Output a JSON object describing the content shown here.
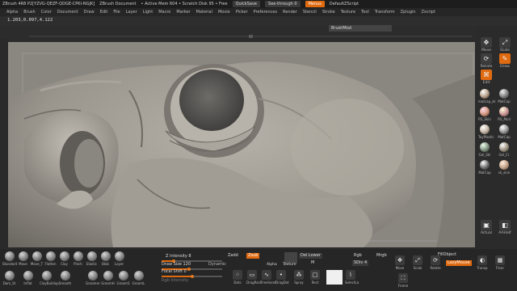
{
  "titlebar": {
    "app": "ZBrush 4R8 P2[YZVG-QEZF-QDGE-CPKI-NGJK]",
    "doc": "ZBrush Document",
    "mem": "• Active Mem 604 • Scratch Disk 95 • Free",
    "quicksave": "QuickSave",
    "seethrough": "See-through  0",
    "menus": "Menus",
    "script": "DefaultZScript"
  },
  "menubar": [
    "Alpha",
    "Brush",
    "Color",
    "Document",
    "Draw",
    "Edit",
    "File",
    "Layer",
    "Light",
    "Macro",
    "Marker",
    "Material",
    "Movie",
    "Picker",
    "Preferences",
    "Render",
    "Stencil",
    "Stroke",
    "Texture",
    "Tool",
    "Transform",
    "Zplugin",
    "Zscript"
  ],
  "coords": "1.203,0.097,4.122",
  "brush_name": "BrushMod",
  "right_shelf": {
    "move": "Move",
    "scale": "Scale",
    "rotate": "Rotate",
    "draw": "Draw",
    "edit": "Edit",
    "materials": [
      "matcap_sk",
      "MatCap",
      "RS_Skin",
      "RS_Mcd",
      "ToyPlastic",
      "MatCap",
      "Gel_Ski",
      "Gel_Cr",
      "MatCap",
      "sk_skin"
    ],
    "actual": "Actual",
    "aahalf": "AAHalf",
    "floor": "Floor",
    "persp": "Persp"
  },
  "brushes": [
    "Standard",
    "Move",
    "Move_T",
    "Flatten",
    "Clay",
    "Pinch",
    "Elastic",
    "Blob",
    "Layer",
    "Dam_St",
    "Inflat",
    "ClayBuildup",
    "Smooth",
    "Groomer",
    "GroomH",
    "GroomS",
    "GroomL"
  ],
  "controls": {
    "z_intensity": "Z Intensity 8",
    "draw_size": "Draw Size 120",
    "dynamic": "Dynamic",
    "focal_shift": "Focal Shift 0",
    "rgb_intensity": "Rgb Intensity",
    "zadd": "Zadd",
    "zsub": "Zsub",
    "del_lower": "Del Lower",
    "m": "M",
    "rgb": "Rgb",
    "mrgb": "Mrgb",
    "sdiv": "SDiv 4",
    "fill_object": "FillObject",
    "lazy_mouse": "LazyMouse",
    "alpha": "Alpha",
    "texture": "Texture",
    "strokes": [
      "Dots",
      "DragRect",
      "Freehand",
      "DragDot",
      "Spray",
      "Rect"
    ],
    "select_la": "SelectLa",
    "frame": "Frame",
    "move": "Move",
    "scale": "Scale",
    "rotate": "Rotate",
    "transp": "Transp"
  }
}
